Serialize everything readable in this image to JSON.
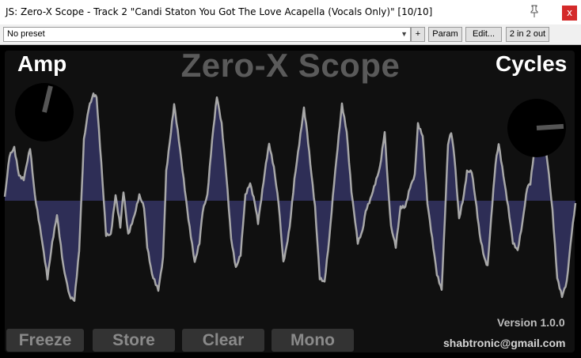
{
  "window": {
    "title": "JS: Zero-X Scope - Track 2 \"Candi Staton You Got The Love Acapella (Vocals Only)\" [10/10]",
    "close_glyph": "x",
    "pin_icon": "pin-icon"
  },
  "toolbar": {
    "preset_value": "No preset",
    "add_label": "+",
    "param_label": "Param",
    "edit_label": "Edit...",
    "routing_label": "2 in 2 out",
    "checkbox_checked": true
  },
  "plugin": {
    "title": "Zero-X Scope",
    "amp_label": "Amp",
    "cycles_label": "Cycles",
    "version": "Version 1.0.0",
    "email": "shabtronic@gmail.com",
    "buttons": {
      "freeze": "Freeze",
      "store": "Store",
      "clear": "Clear",
      "mono": "Mono"
    },
    "colors": {
      "wave_fill": "#2e2e56",
      "wave_line": "#a8a8a8",
      "background": "#101010"
    },
    "amp_knob_value": 0.55,
    "cycles_knob_value": 0.82
  }
}
